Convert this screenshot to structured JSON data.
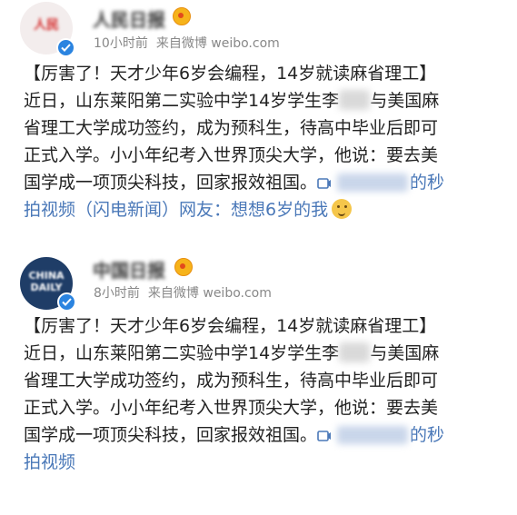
{
  "posts": [
    {
      "avatar_text": "人民",
      "username": "人民日报",
      "time": "10小时前",
      "source": "来自微博 weibo.com",
      "lines": [
        "【厉害了！天才少年6岁会编程，14岁就读麻省理工】",
        "近日，山东莱阳第二实验中学14岁学生李",
        "与美国麻",
        "省理工大学成功签约，成为预科生，待高中毕业后即可",
        "正式入学。小小年纪考入世界顶尖大学，他说：要去美",
        "国学成一项顶尖科技，回家报效祖国。",
        "的秒",
        "拍视频（闪电新闻）网友：想想6岁的我"
      ]
    },
    {
      "avatar_text": "CHINA DAILY",
      "username": "中国日报",
      "time": "8小时前",
      "source": "来自微博 weibo.com",
      "lines": [
        "【厉害了！天才少年6岁会编程，14岁就读麻省理工】",
        "近日，山东莱阳第二实验中学14岁学生李",
        "与美国麻",
        "省理工大学成功签约，成为预科生，待高中毕业后即可",
        "正式入学。小小年纪考入世界顶尖大学，他说：要去美",
        "国学成一项顶尖科技，回家报效祖国。",
        "的秒",
        "拍视频"
      ]
    }
  ],
  "colors": {
    "link": "#4a78b8",
    "meta": "#888888",
    "verified": "#2b84e0"
  },
  "icons": [
    "verified-badge-icon",
    "vip-badge-icon",
    "video-link-icon",
    "emoji-icon"
  ]
}
